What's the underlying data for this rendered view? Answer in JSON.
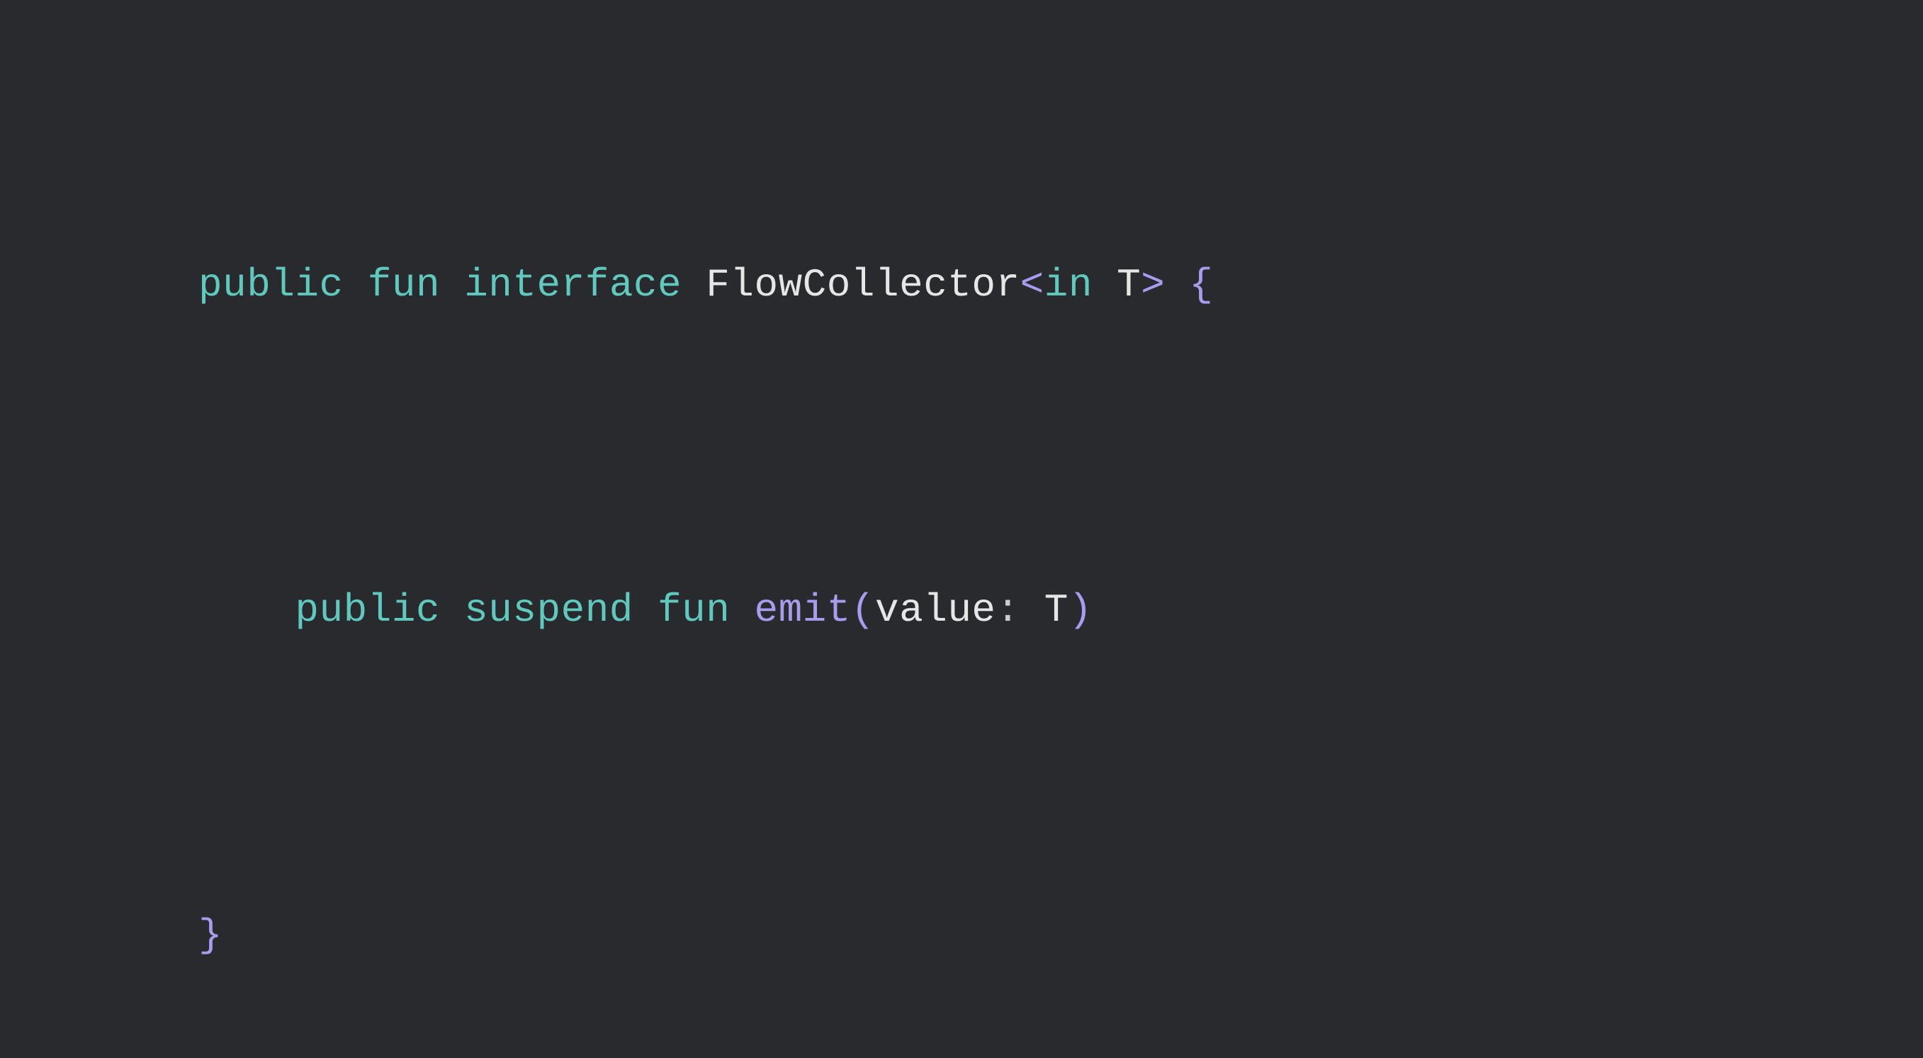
{
  "code": {
    "line1": {
      "t1": "public",
      "t2": " ",
      "t3": "fun",
      "t4": " ",
      "t5": "interface",
      "t6": " ",
      "t7": "FlowCollector",
      "t8": "<",
      "t9": "in",
      "t10": " ",
      "t11": "T",
      "t12": ">",
      "t13": " ",
      "t14": "{"
    },
    "line2": {
      "t0": "    ",
      "t1": "public",
      "t2": " ",
      "t3": "suspend",
      "t4": " ",
      "t5": "fun",
      "t6": " ",
      "t7": "emit",
      "t8": "(",
      "t9": "value",
      "t10": ":",
      "t11": " ",
      "t12": "T",
      "t13": ")"
    },
    "line3": {
      "t1": "}"
    }
  }
}
